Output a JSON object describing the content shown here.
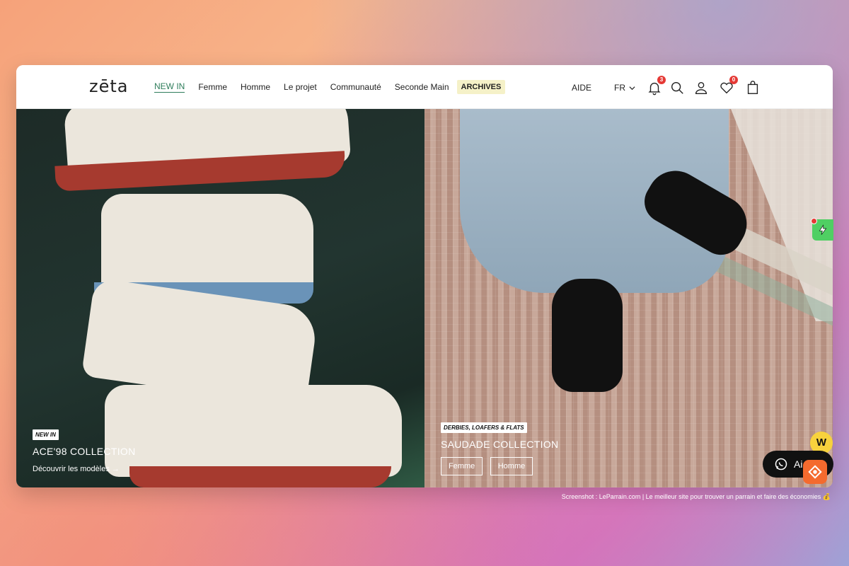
{
  "header": {
    "logo": "zēta",
    "nav": [
      {
        "label": "NEW IN"
      },
      {
        "label": "Femme"
      },
      {
        "label": "Homme"
      },
      {
        "label": "Le projet"
      },
      {
        "label": "Communauté"
      },
      {
        "label": "Seconde Main"
      },
      {
        "label": "ARCHIVES"
      }
    ],
    "help": "AIDE",
    "lang": "FR",
    "notification_count": "3",
    "wishlist_count": "0"
  },
  "left_panel": {
    "tag": "NEW IN",
    "title": "ACE'98 COLLECTION",
    "link": "Découvrir les modèles →"
  },
  "right_panel": {
    "tag": "DERBIES, LOAFERS & FLATS",
    "title": "SAUDADE COLLECTION",
    "buttons": [
      {
        "label": "Femme"
      },
      {
        "label": "Homme"
      }
    ]
  },
  "widgets": {
    "whatsapp_label": "Ai",
    "w_badge": "W"
  },
  "footer_note": "Screenshot : LeParrain.com | Le meilleur site pour trouver un parrain et faire des économies 💰",
  "colors": {
    "accent": "#2e7d5b",
    "archives_bg": "#f5f1c8",
    "badge": "#e53935"
  }
}
